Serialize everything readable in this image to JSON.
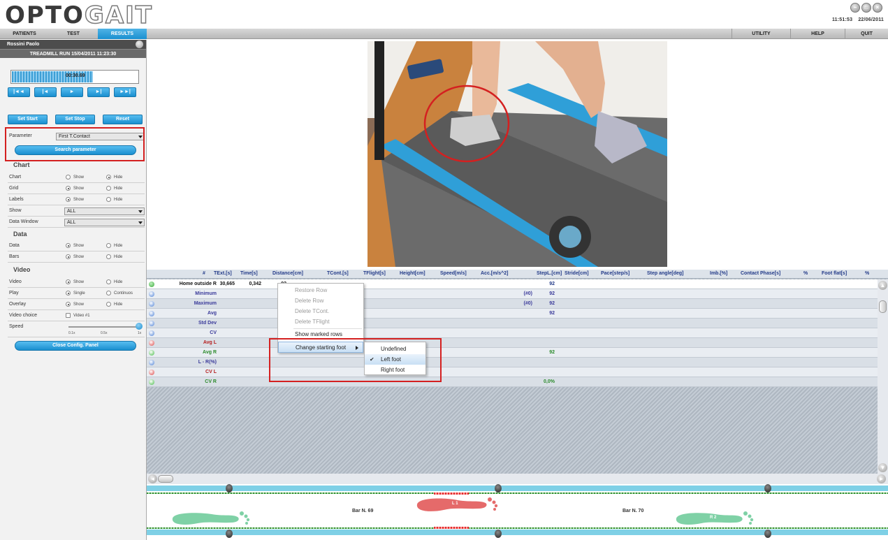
{
  "app": {
    "logo_dark": "OPTO",
    "logo_light": "GAIT",
    "time": "11:51:53",
    "date": "22/06/2011"
  },
  "tabs": [
    "PATIENTS",
    "TEST",
    "RESULTS"
  ],
  "right_menu": [
    "UTILITY",
    "HELP",
    "QUIT"
  ],
  "panel": {
    "patient": "Rossini Paolo",
    "session": "TREADMILL RUN 15/04/2011 11:23:30",
    "elapsed": "00:30.69",
    "progress_fraction": 0.64,
    "transport": [
      "|◄◄",
      "|◄",
      "►",
      "►|",
      "►►|"
    ],
    "set_start": "Set Start",
    "set_stop": "Set Stop",
    "reset": "Reset",
    "parameter_label": "Parameter",
    "parameter_value": "First T.Contact",
    "search_button": "Search parameter",
    "chart_title": "Chart",
    "chart_label": "Chart",
    "grid_label": "Grid",
    "labels_label": "Labels",
    "show_label": "Show",
    "show_value": "ALL",
    "data_window_label": "Data Window",
    "data_window_value": "ALL",
    "data_title": "Data",
    "data_label": "Data",
    "bars_label": "Bars",
    "video_title": "Video",
    "video_label": "Video",
    "play_label": "Play",
    "overlay_label": "Overlay",
    "video_choice_label": "Video choice",
    "video_choice_value": "Video #1",
    "speed_label": "Speed",
    "speed_ticks": [
      "0.1x",
      "0.5x",
      "1x"
    ],
    "opt_show": "Show",
    "opt_hide": "Hide",
    "opt_single": "Single",
    "opt_continuos": "Continuos",
    "close_button": "Close Config. Panel"
  },
  "table": {
    "columns": [
      "#",
      "TExt.[s]",
      "Time[s]",
      "Distance[cm]",
      "TCont.[s]",
      "TFlight[s]",
      "Height[cm]",
      "Speed[m/s]",
      "Acc.[m/s^2]",
      "StepL.[cm]",
      "Stride[cm]",
      "Pace[step/s]",
      "Step angle[deg]",
      "Imb.[%]",
      "Contact Phase[s]",
      "%",
      "Foot flat[s]",
      "%"
    ],
    "first_row": {
      "name": "Home outside R",
      "text": "30,665",
      "time": "0,342",
      "distance": "92",
      "stepl": "92"
    },
    "rows": [
      {
        "name": "Minimum",
        "hash": "(#0)",
        "stepl": "92"
      },
      {
        "name": "Maximum",
        "hash": "(#0)",
        "stepl": "92"
      },
      {
        "name": "Avg",
        "stepl": "92"
      },
      {
        "name": "Std Dev"
      },
      {
        "name": "CV"
      },
      {
        "name": "Avg L"
      },
      {
        "name": "Avg R",
        "stepl": "92"
      },
      {
        "name": "L - R(%)"
      },
      {
        "name": "CV L"
      },
      {
        "name": "CV R",
        "stepl": "0,0%"
      }
    ]
  },
  "context_menu": {
    "items": [
      "Restore Row",
      "Delete Row",
      "Delete TCont.",
      "Delete TFlight",
      "Show marked rows",
      "Change starting foot"
    ],
    "submenu": [
      "Undefined",
      "Left foot",
      "Right foot"
    ]
  },
  "footbar": {
    "bar_a": "Bar N. 69",
    "bar_b": "Bar N. 70",
    "foot_l": "L 1",
    "foot_r": "R 2"
  },
  "colors": {
    "accent": "#1a8fcf",
    "highlight_red": "#d42020",
    "left_foot": "#e56a6a",
    "right_foot": "#7fd1a6"
  }
}
